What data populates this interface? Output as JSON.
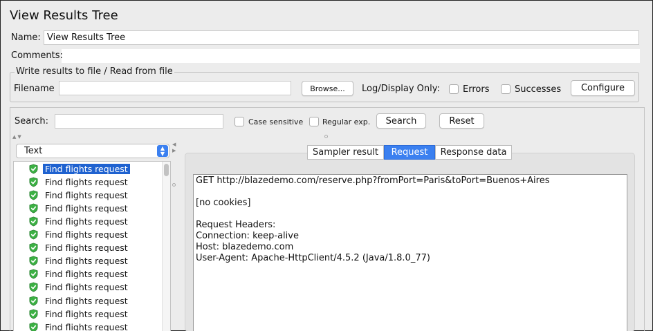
{
  "window": {
    "title": "View Results Tree"
  },
  "name_field": {
    "label": "Name:",
    "value": "View Results Tree"
  },
  "comments": {
    "label": "Comments:"
  },
  "file_group": {
    "title": "Write results to file / Read from file",
    "filename_label": "Filename",
    "filename_value": "",
    "browse_label": "Browse...",
    "log_display_label": "Log/Display Only:",
    "errors_label": "Errors",
    "successes_label": "Successes",
    "configure_label": "Configure"
  },
  "search": {
    "label": "Search:",
    "value": "",
    "case_sensitive_label": "Case sensitive",
    "regular_exp_label": "Regular exp.",
    "search_button": "Search",
    "reset_button": "Reset"
  },
  "renderer_select": {
    "value": "Text"
  },
  "tree": {
    "items": [
      "Find flights request",
      "Find flights request",
      "Find flights request",
      "Find flights request",
      "Find flights request",
      "Find flights request",
      "Find flights request",
      "Find flights request",
      "Find flights request",
      "Find flights request",
      "Find flights request",
      "Find flights request",
      "Find flights request"
    ],
    "selected_index": 0
  },
  "result_tabs": {
    "tabs": [
      "Sampler result",
      "Request",
      "Response data"
    ],
    "active_index": 1
  },
  "request_body": {
    "lines": [
      "GET http://blazedemo.com/reserve.php?fromPort=Paris&toPort=Buenos+Aires",
      "",
      "[no cookies]",
      "",
      "Request Headers:",
      "Connection: keep-alive",
      "Host: blazedemo.com",
      "User-Agent: Apache-HttpClient/4.5.2 (Java/1.8.0_77)"
    ]
  },
  "colors": {
    "selection": "#1f62d0",
    "active_tab": "#3b80f0",
    "success_icon": "#3bb143"
  }
}
